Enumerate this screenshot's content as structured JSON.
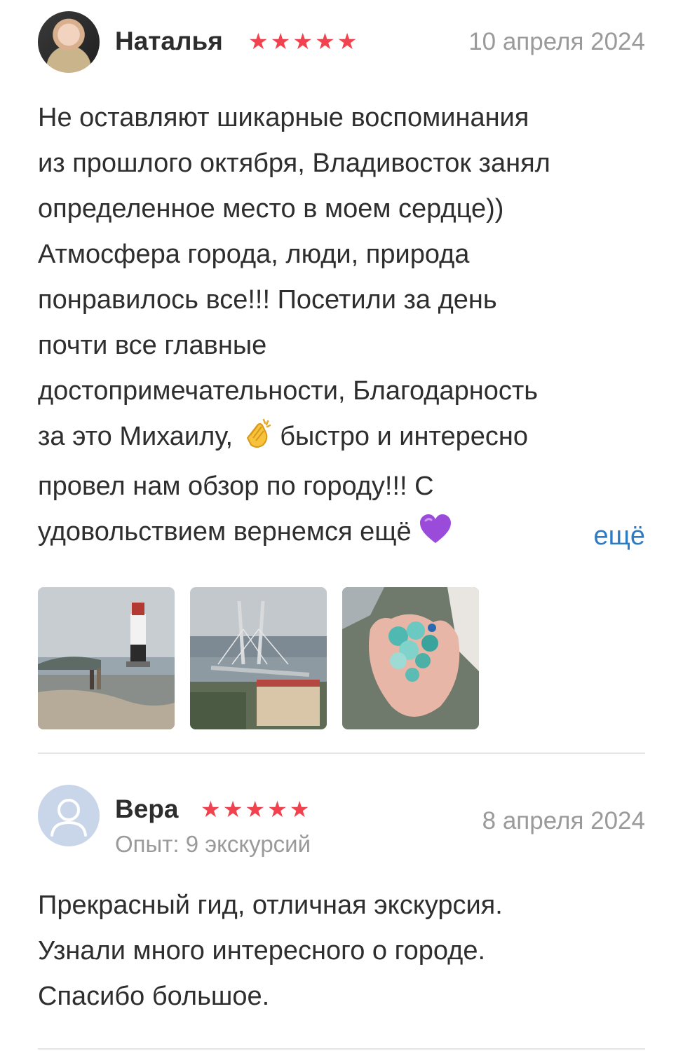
{
  "reviews": [
    {
      "author": "Наталья",
      "stars": "★★★★★",
      "rating": 5,
      "date": "10 апреля 2024",
      "text_lines": [
        "Не оставляют шикарные воспоминания",
        "из прошлого октября, Владивосток занял",
        "определенное место в моем сердце))",
        "Атмосфера города, люди, природа",
        "понравилось все!!! Посетили за день",
        "почти все главные",
        "достопримечательности, Благодарность",
        "за это Михаилу,",
        "быстро и интересно",
        "провел нам обзор по городу!!! С",
        "удовольствием вернемся ещё"
      ],
      "more_label": "ещё",
      "photos": [
        "lighthouse-photo",
        "bridge-photo",
        "sea-glass-photo"
      ]
    },
    {
      "author": "Вера",
      "stars": "★★★★★",
      "rating": 5,
      "experience": "Опыт: 9 экскурсий",
      "date": "8 апреля 2024",
      "text_lines": [
        "Прекрасный гид, отличная экскурсия.",
        "Узнали много интересного о городе.",
        "Спасибо большое."
      ]
    }
  ],
  "colors": {
    "star": "#f0434f",
    "link": "#2c7bc4",
    "muted": "#9a9a9a",
    "text": "#2e2e2e",
    "divider": "#e4e4e4"
  }
}
